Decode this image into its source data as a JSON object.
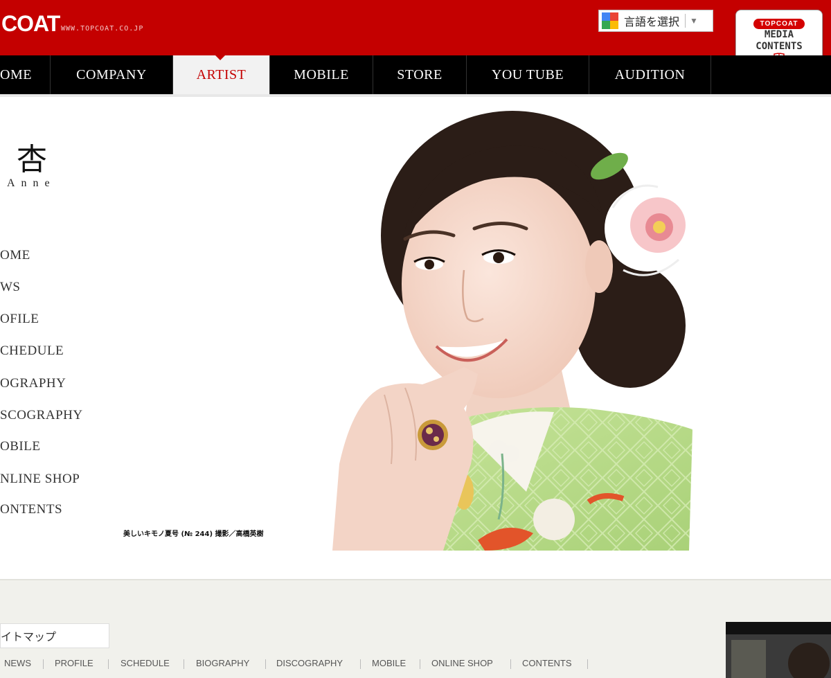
{
  "header": {
    "logo": "COAT",
    "url": "WWW.TOPCOAT.CO.JP",
    "language_select": "言語を選択",
    "media_badge": {
      "pill": "TOPCOAT",
      "line1": "MEDIA",
      "line2": "CONTENTS",
      "icon": "book-icon"
    },
    "bg_color": "#c40000"
  },
  "nav": {
    "items": [
      "OME",
      "COMPANY",
      "ARTIST",
      "MOBILE",
      "STORE",
      "YOU TUBE",
      "AUDITION"
    ],
    "active": "ARTIST"
  },
  "artist": {
    "name_kanji": "杏",
    "name_roman": "Anne"
  },
  "side_menu": {
    "items": [
      "OME",
      "WS",
      "OFILE",
      "CHEDULE",
      "OGRAPHY",
      "SCOGRAPHY",
      "OBILE",
      "NLINE SHOP",
      "ONTENTS"
    ]
  },
  "caption": "美しいキモノ夏号 (№ 244) 撮影／高橋英樹",
  "footer": {
    "sitemap": "イトマップ",
    "links": [
      "NEWS",
      "PROFILE",
      "SCHEDULE",
      "BIOGRAPHY",
      "DISCOGRAPHY",
      "MOBILE",
      "ONLINE SHOP",
      "CONTENTS"
    ]
  }
}
